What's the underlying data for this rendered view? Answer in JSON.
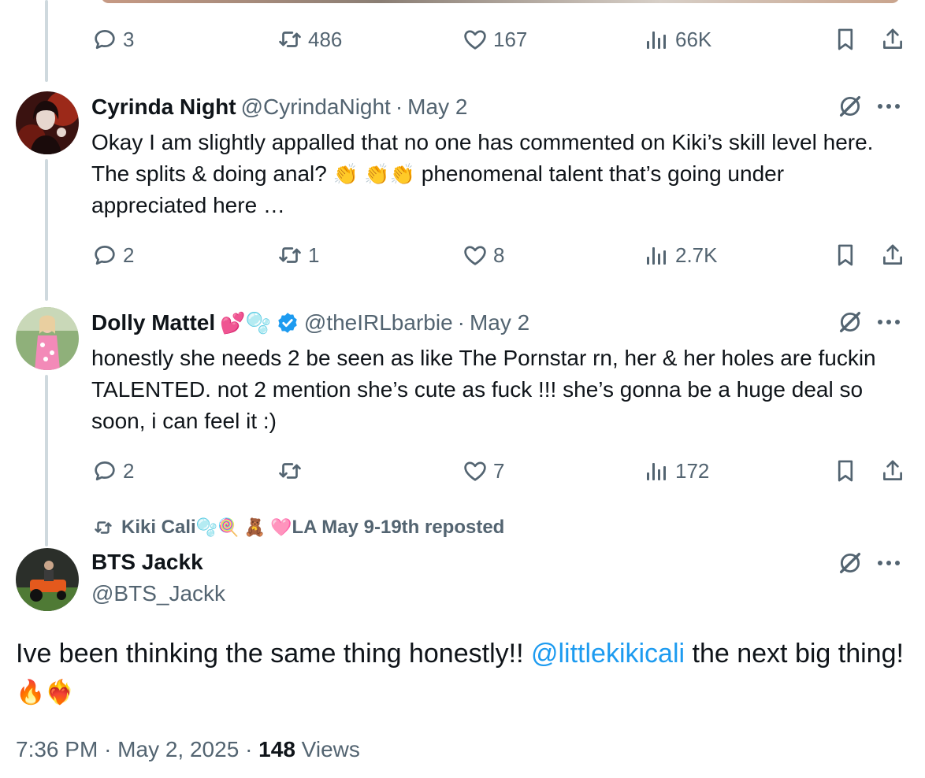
{
  "top_tweet": {
    "replies": "3",
    "reposts": "486",
    "likes": "167",
    "views": "66K"
  },
  "reply1": {
    "name": "Cyrinda Night",
    "handle": "@CyrindaNight",
    "dot": "·",
    "date": "May 2",
    "text_part1": "Okay I am slightly appalled that no one has commented on Kiki’s skill level here. The splits & doing anal?",
    "emojis": "👏 👏👏",
    "text_part2": "phenomenal talent that’s going under appreciated here …",
    "replies": "2",
    "reposts": "1",
    "likes": "8",
    "views": "2.7K"
  },
  "reply2": {
    "name": "Dolly Mattel",
    "name_emojis": "💕🫧",
    "handle": "@theIRLbarbie",
    "dot": "·",
    "date": "May 2",
    "text": "honestly she needs 2 be seen as like The Pornstar rn, her & her holes are fuckin TALENTED. not 2 mention she’s cute as fuck !!! she’s gonna be a huge deal so soon, i can feel it :)",
    "replies": "2",
    "reposts": "",
    "likes": "7",
    "views": "172"
  },
  "repost_banner": {
    "name": "Kiki Cali",
    "emojis": "🫧🍭 🧸 🩷",
    "suffix": "LA May 9-19th reposted"
  },
  "main_tweet": {
    "name": "BTS Jackk",
    "handle": "@BTS_Jackk",
    "text_before": "Ive been thinking the same thing honestly!! ",
    "mention": "@littlekikicali",
    "text_after": " the next big thing! ",
    "emojis": "🔥❤️‍🔥",
    "time": "7:36 PM",
    "dot": "·",
    "date": "May 2, 2025",
    "views_count": "148",
    "views_label": "Views"
  },
  "colors": {
    "text": "#0f1419",
    "secondary": "#536471",
    "link": "#1d9bf0",
    "verified": "#1d9bf0",
    "thread_line": "#cfd9de"
  },
  "icons": [
    "reply-icon",
    "repost-icon",
    "like-icon",
    "views-icon",
    "bookmark-icon",
    "share-icon",
    "grok-icon",
    "more-icon",
    "verified-badge-icon"
  ]
}
